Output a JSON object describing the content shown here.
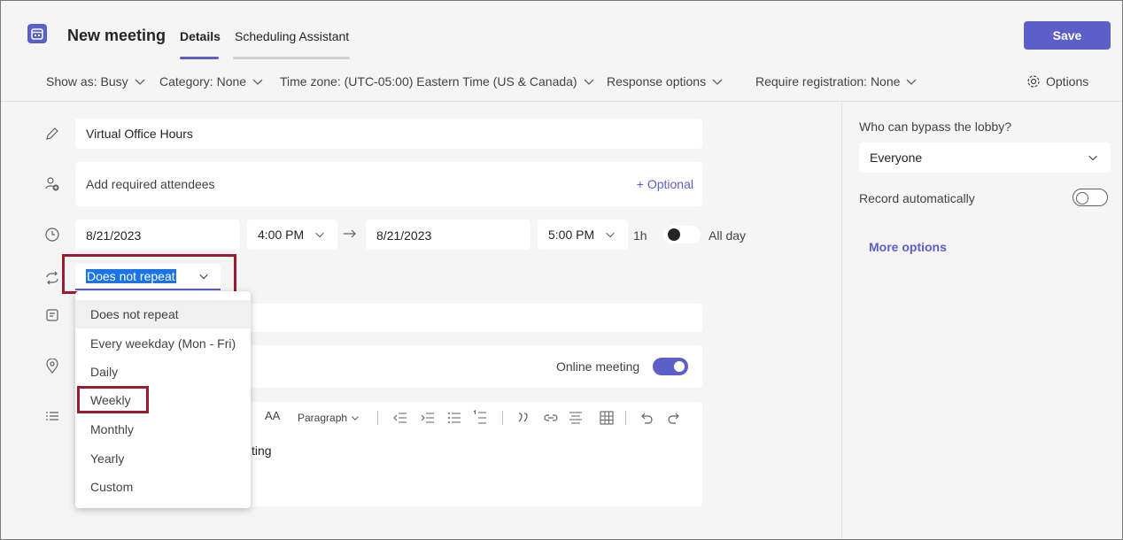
{
  "header": {
    "title": "New meeting",
    "tabs": [
      {
        "label": "Details",
        "active": true
      },
      {
        "label": "Scheduling Assistant",
        "active": false
      }
    ],
    "save_label": "Save"
  },
  "toolbar": {
    "show_as": "Show as: Busy",
    "category": "Category: None",
    "time_zone": "Time zone: (UTC-05:00) Eastern Time (US & Canada)",
    "response_options": "Response options",
    "require_registration": "Require registration: None",
    "options": "Options"
  },
  "form": {
    "title_value": "Virtual Office Hours",
    "attendees_placeholder": "Add required attendees",
    "optional_label": "+ Optional",
    "start_date": "8/21/2023",
    "start_time": "4:00 PM",
    "end_date": "8/21/2023",
    "end_time": "5:00 PM",
    "duration": "1h",
    "all_day_label": "All day",
    "repeat_value": "Does not repeat",
    "online_meeting_label": "Online meeting",
    "body_partial": "ting"
  },
  "editor_toolbar": {
    "font_size_glyph": "AA",
    "paragraph_label": "Paragraph"
  },
  "repeat_dropdown": {
    "options": [
      "Does not repeat",
      "Every weekday (Mon - Fri)",
      "Daily",
      "Weekly",
      "Monthly",
      "Yearly",
      "Custom"
    ],
    "selected": "Does not repeat",
    "highlighted": "Weekly"
  },
  "side_panel": {
    "lobby_label": "Who can bypass the lobby?",
    "lobby_value": "Everyone",
    "record_label": "Record automatically",
    "record_on": false,
    "more_options": "More options"
  },
  "colors": {
    "accent": "#5b5fc7",
    "annotation": "#9b1c2c",
    "selection": "#1a73e8"
  }
}
